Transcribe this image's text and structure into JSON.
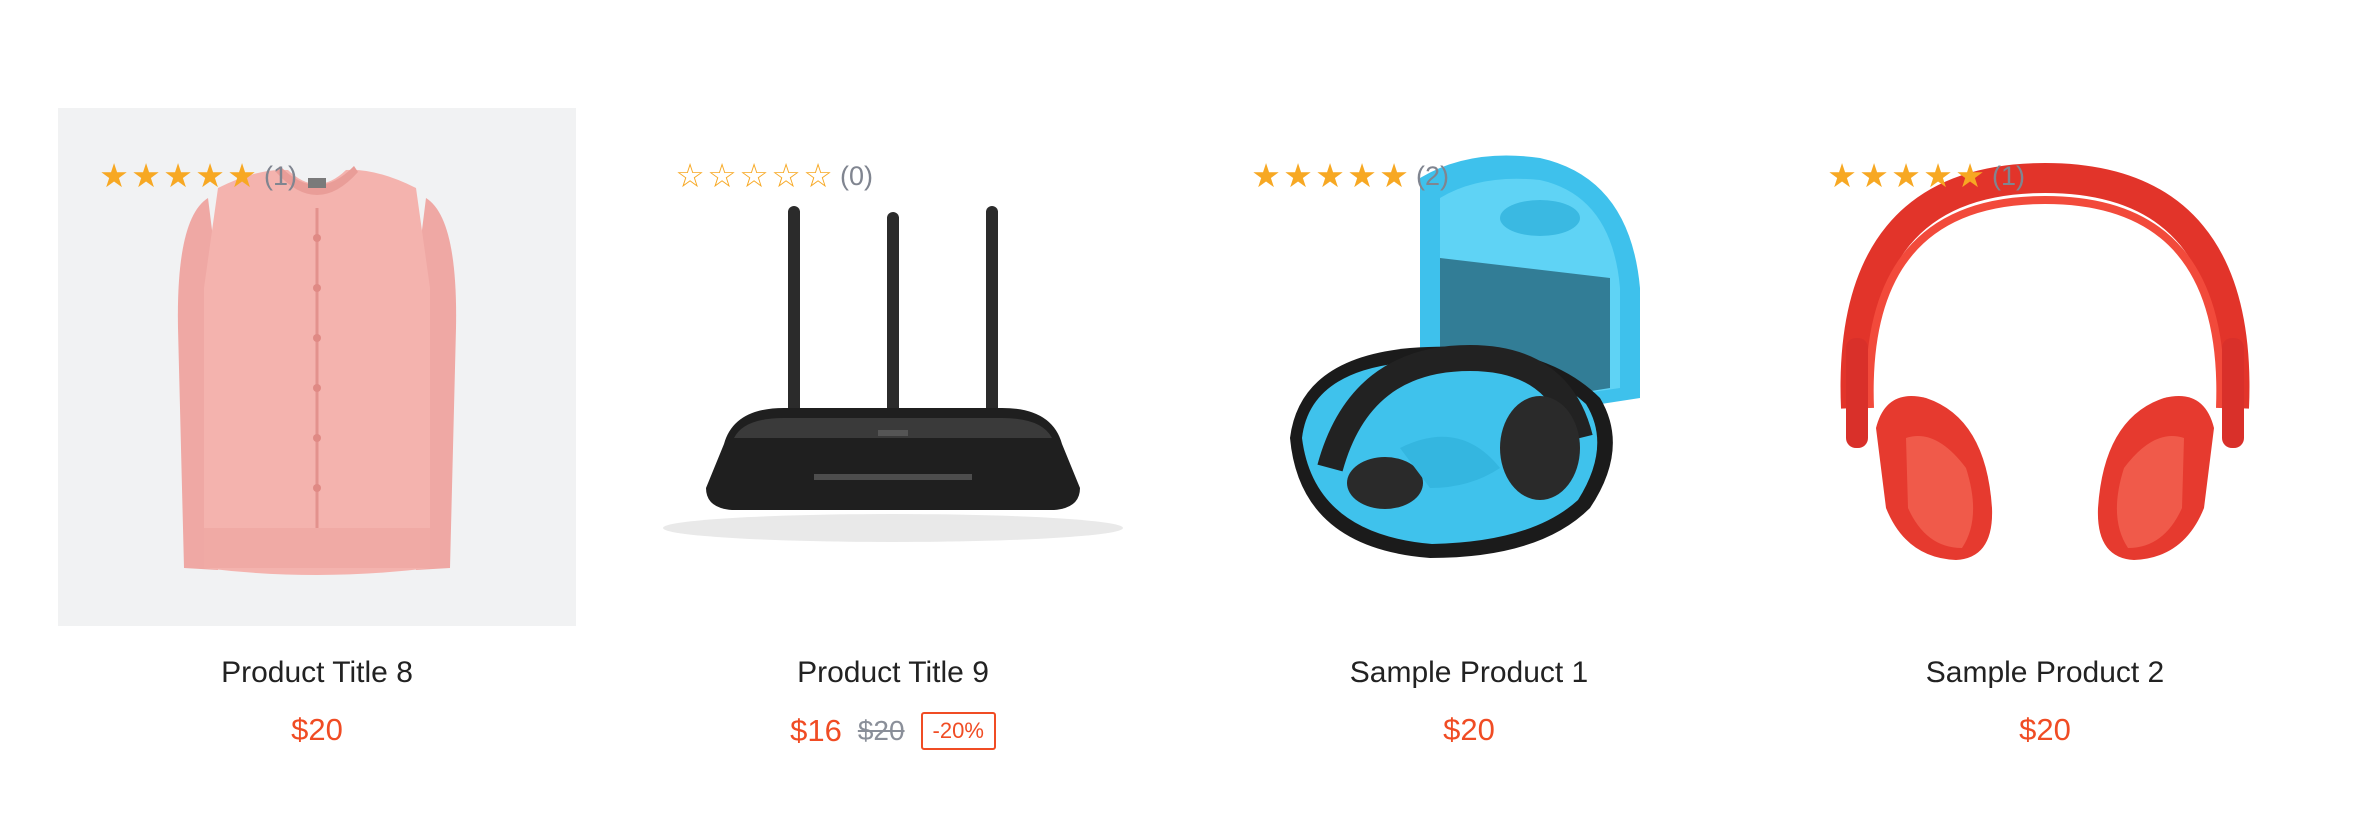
{
  "products": [
    {
      "title": "Product Title 8",
      "price": "$20",
      "rating_stars": 5,
      "rating_count": "(1)",
      "image": "pink-cardigan-image"
    },
    {
      "title": "Product Title 9",
      "price": "$16",
      "old_price": "$20",
      "discount": "-20%",
      "rating_stars": 0,
      "rating_count": "(0)",
      "image": "wifi-router-image"
    },
    {
      "title": "Sample Product 1",
      "price": "$20",
      "rating_stars": 5,
      "rating_count": "(2)",
      "image": "headphone-case-image"
    },
    {
      "title": "Sample Product 2",
      "price": "$20",
      "rating_stars": 5,
      "rating_count": "(1)",
      "image": "red-headphones-image"
    }
  ],
  "colors": {
    "price": "#f04c24",
    "star": "#f7a823",
    "muted": "#808590",
    "text": "#222222"
  }
}
